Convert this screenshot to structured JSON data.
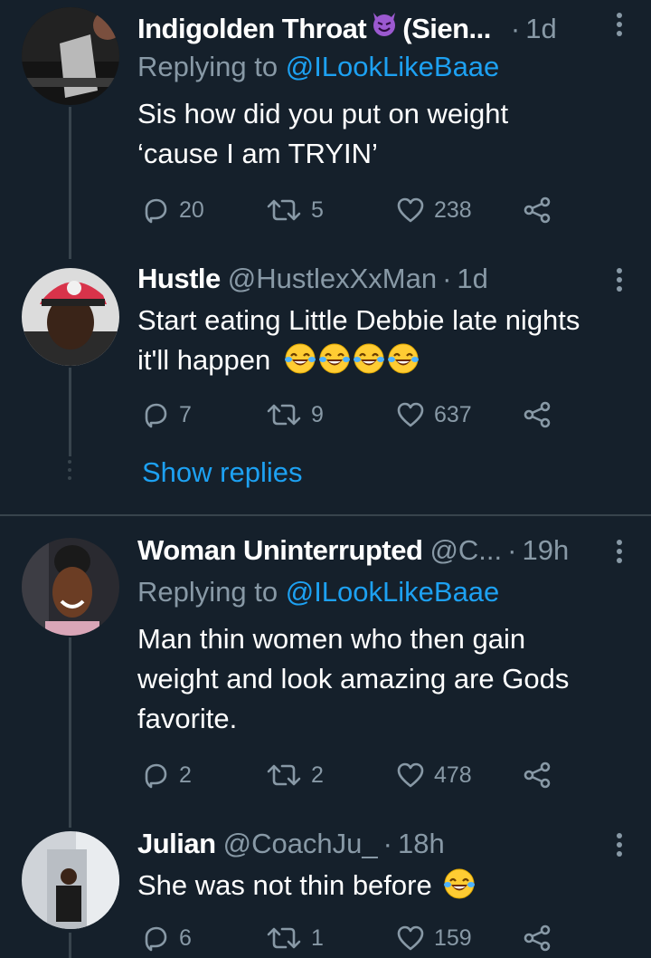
{
  "tweets": [
    {
      "name": "Indigolden Throat",
      "name_suffix": "(Sien...",
      "handle": "",
      "separator": "·",
      "time": "1d",
      "replying_label": "Replying to",
      "replying_handle": "@ILookLikeBaae",
      "body_lines": [
        "Sis how did you put on weight",
        "‘cause I am TRYIN’"
      ],
      "replies": "20",
      "retweets": "5",
      "likes": "238"
    },
    {
      "name": "Hustle",
      "handle": "@HustlexXxMan",
      "separator": "·",
      "time": "1d",
      "body_lines": [
        "Start eating Little Debbie late nights",
        "it'll happen"
      ],
      "body_emoji": "face-with-tears-of-joy x4",
      "replies": "7",
      "retweets": "9",
      "likes": "637"
    },
    {
      "name": "Woman Uninterrupted",
      "handle": "@C...",
      "separator": "·",
      "time": "19h",
      "replying_label": "Replying to",
      "replying_handle": "@ILookLikeBaae",
      "body_lines": [
        "Man thin women who then gain",
        "weight and look amazing are Gods",
        "favorite."
      ],
      "replies": "2",
      "retweets": "2",
      "likes": "478"
    },
    {
      "name": "Julian",
      "handle": "@CoachJu_",
      "separator": "·",
      "time": "18h",
      "body_lines": [
        "She was not thin before"
      ],
      "body_emoji": "face-with-tears-of-joy x1",
      "replies": "6",
      "retweets": "1",
      "likes": "159"
    }
  ],
  "show_replies_label": "Show replies",
  "colors": {
    "background": "#15202b",
    "secondary_text": "#8899a6",
    "link": "#1da1f2",
    "divider": "#38444d"
  },
  "icons": [
    "reply-icon",
    "retweet-icon",
    "like-icon",
    "share-icon",
    "more-options-icon",
    "devil-emoji-icon",
    "laughing-emoji-icon"
  ]
}
